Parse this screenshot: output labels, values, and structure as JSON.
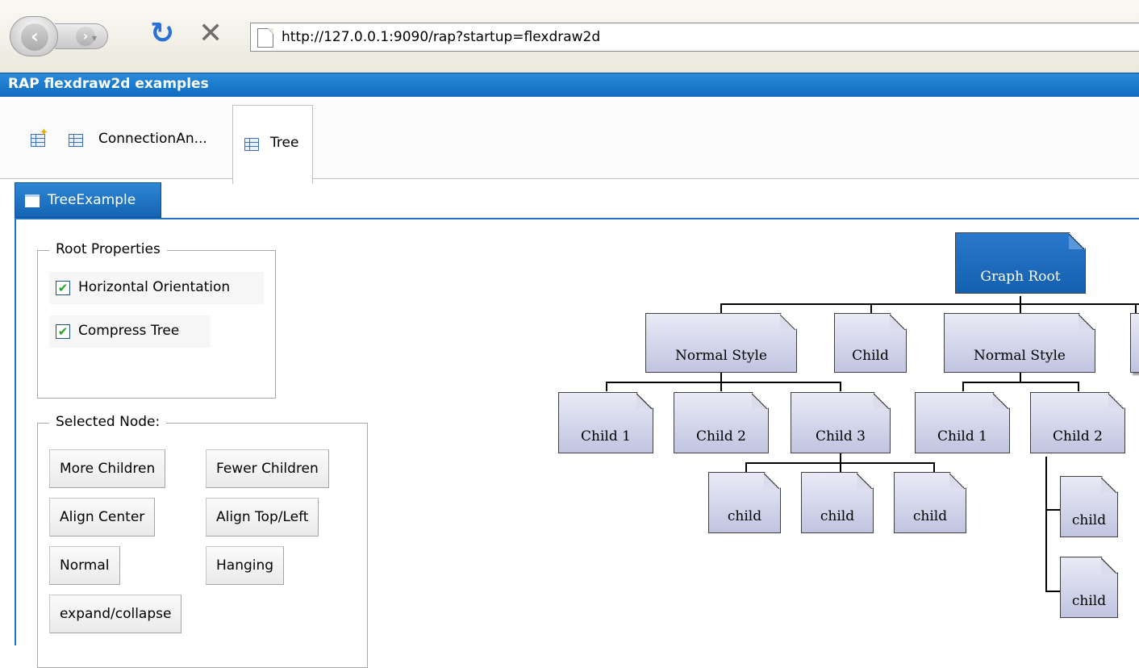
{
  "browser": {
    "back_glyph": "‹",
    "forward_glyph": "›",
    "history_glyph": "▾",
    "reload_glyph": "↻",
    "stop_glyph": "✕",
    "url": "http://127.0.0.1:9090/rap?startup=flexdraw2d"
  },
  "app": {
    "title": "RAP flexdraw2d examples"
  },
  "perspectives": {
    "items": [
      {
        "label": "ConnectionAn..."
      },
      {
        "label": "Tree",
        "active": true
      }
    ]
  },
  "view": {
    "tab_label": "TreeExample"
  },
  "root_properties": {
    "legend": "Root Properties",
    "options": [
      {
        "label": "Horizontal Orientation",
        "checked": true,
        "mark": "✔"
      },
      {
        "label": "Compress Tree",
        "checked": true,
        "mark": "✔"
      }
    ]
  },
  "selected_node": {
    "legend": "Selected Node:",
    "buttons": [
      {
        "label": "More Children"
      },
      {
        "label": "Fewer Children"
      },
      {
        "label": "Align Center"
      },
      {
        "label": "Align Top/Left"
      },
      {
        "label": "Normal"
      },
      {
        "label": "Hanging"
      },
      {
        "label": "expand/collapse"
      }
    ]
  },
  "tree": {
    "root": "Graph Root",
    "level1": [
      "Normal Style",
      "Child",
      "Normal Style",
      ""
    ],
    "level2_left": [
      "Child 1",
      "Child 2",
      "Child 3"
    ],
    "level3_left": [
      "child",
      "child",
      "child"
    ],
    "level2_right": [
      "Child 1",
      "Child 2"
    ],
    "level3_right": [
      "child",
      "child"
    ]
  },
  "colors": {
    "title_bar": "#1a7ccc",
    "node_fill": "#c8cce6",
    "root_fill": "#1f6fc2",
    "checkbox_mark": "#2aa12a"
  }
}
